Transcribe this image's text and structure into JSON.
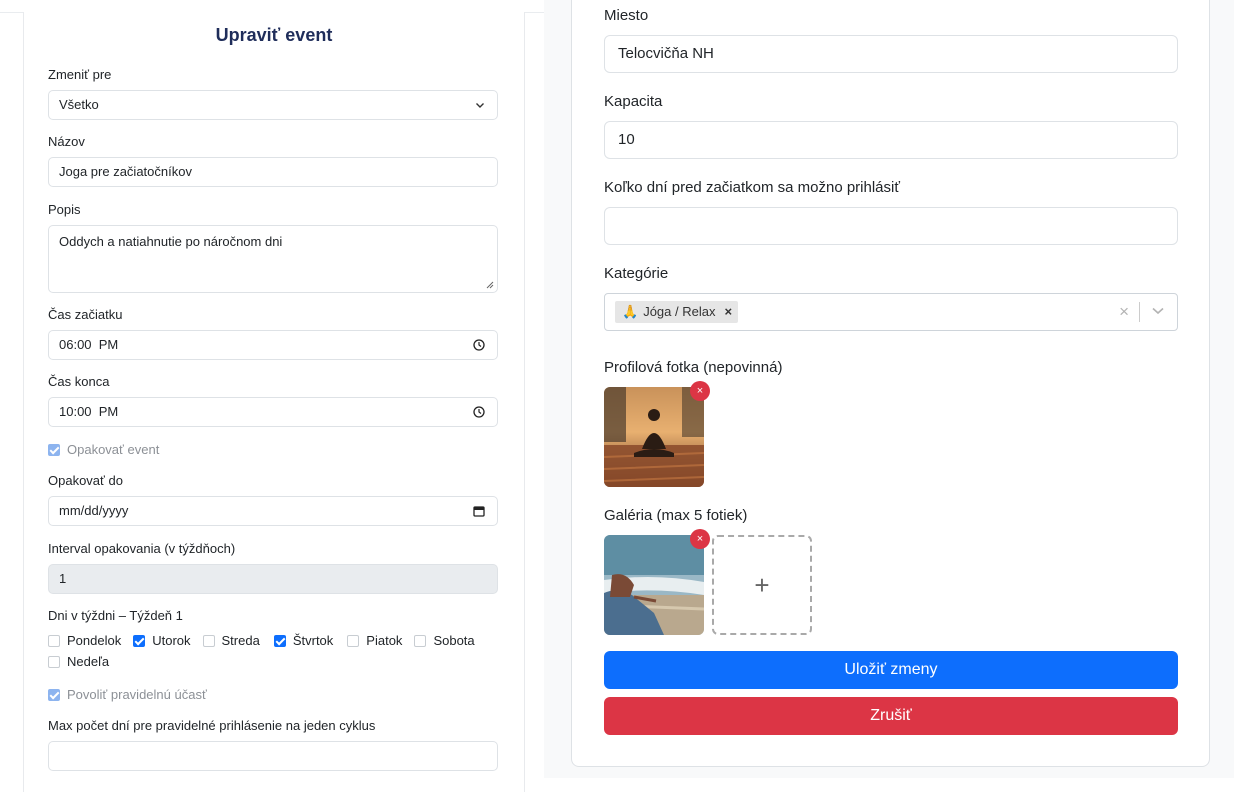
{
  "left": {
    "title": "Upraviť event",
    "change_for": {
      "label": "Zmeniť pre",
      "value": "Všetko"
    },
    "name": {
      "label": "Názov",
      "value": "Joga pre začiatočníkov"
    },
    "description": {
      "label": "Popis",
      "value": "Oddych a natiahnutie po náročnom dni"
    },
    "start_time": {
      "label": "Čas začiatku",
      "value": "06:00  PM"
    },
    "end_time": {
      "label": "Čas konca",
      "value": "10:00  PM"
    },
    "repeat_event": {
      "label": "Opakovať event",
      "checked": true
    },
    "repeat_until": {
      "label": "Opakovať do",
      "value": "mm/dd/yyyy"
    },
    "interval": {
      "label": "Interval opakovania (v týždňoch)",
      "value": "1"
    },
    "weekdays": {
      "label": "Dni v týždni – Týždeň 1",
      "days": [
        {
          "label": "Pondelok",
          "checked": false
        },
        {
          "label": "Utorok",
          "checked": true
        },
        {
          "label": "Streda",
          "checked": false
        },
        {
          "label": "Štvrtok",
          "checked": true
        },
        {
          "label": "Piatok",
          "checked": false
        },
        {
          "label": "Sobota",
          "checked": false
        },
        {
          "label": "Nedeľa",
          "checked": false
        }
      ]
    },
    "regular_participation": {
      "label": "Povoliť pravidelnú účasť",
      "checked": true
    },
    "max_days": {
      "label": "Max počet dní pre pravidelné prihlásenie na jeden cyklus",
      "value": ""
    }
  },
  "right": {
    "location": {
      "label": "Miesto",
      "value": "Telocvičňa NH"
    },
    "capacity": {
      "label": "Kapacita",
      "value": "10"
    },
    "signup_days": {
      "label": "Koľko dní pred začiatkom sa možno prihlásiť",
      "value": ""
    },
    "categories": {
      "label": "Kategórie",
      "chip_emoji": "🙏",
      "chip_label": "Jóga / Relax",
      "chip_remove": "×",
      "clear": "×"
    },
    "profile_photo": {
      "label": "Profilová fotka (nepovinná)",
      "remove": "×"
    },
    "gallery": {
      "label": "Galéria (max 5 fotiek)",
      "remove": "×",
      "add": "+"
    },
    "save_label": "Uložiť zmeny",
    "cancel_label": "Zrušiť"
  },
  "colors": {
    "primary": "#0d6efd",
    "danger": "#dc3545",
    "title": "#1f2d5a"
  },
  "icons": [
    "chevron-down-icon",
    "clock-icon",
    "calendar-icon",
    "close-icon",
    "plus-icon"
  ]
}
